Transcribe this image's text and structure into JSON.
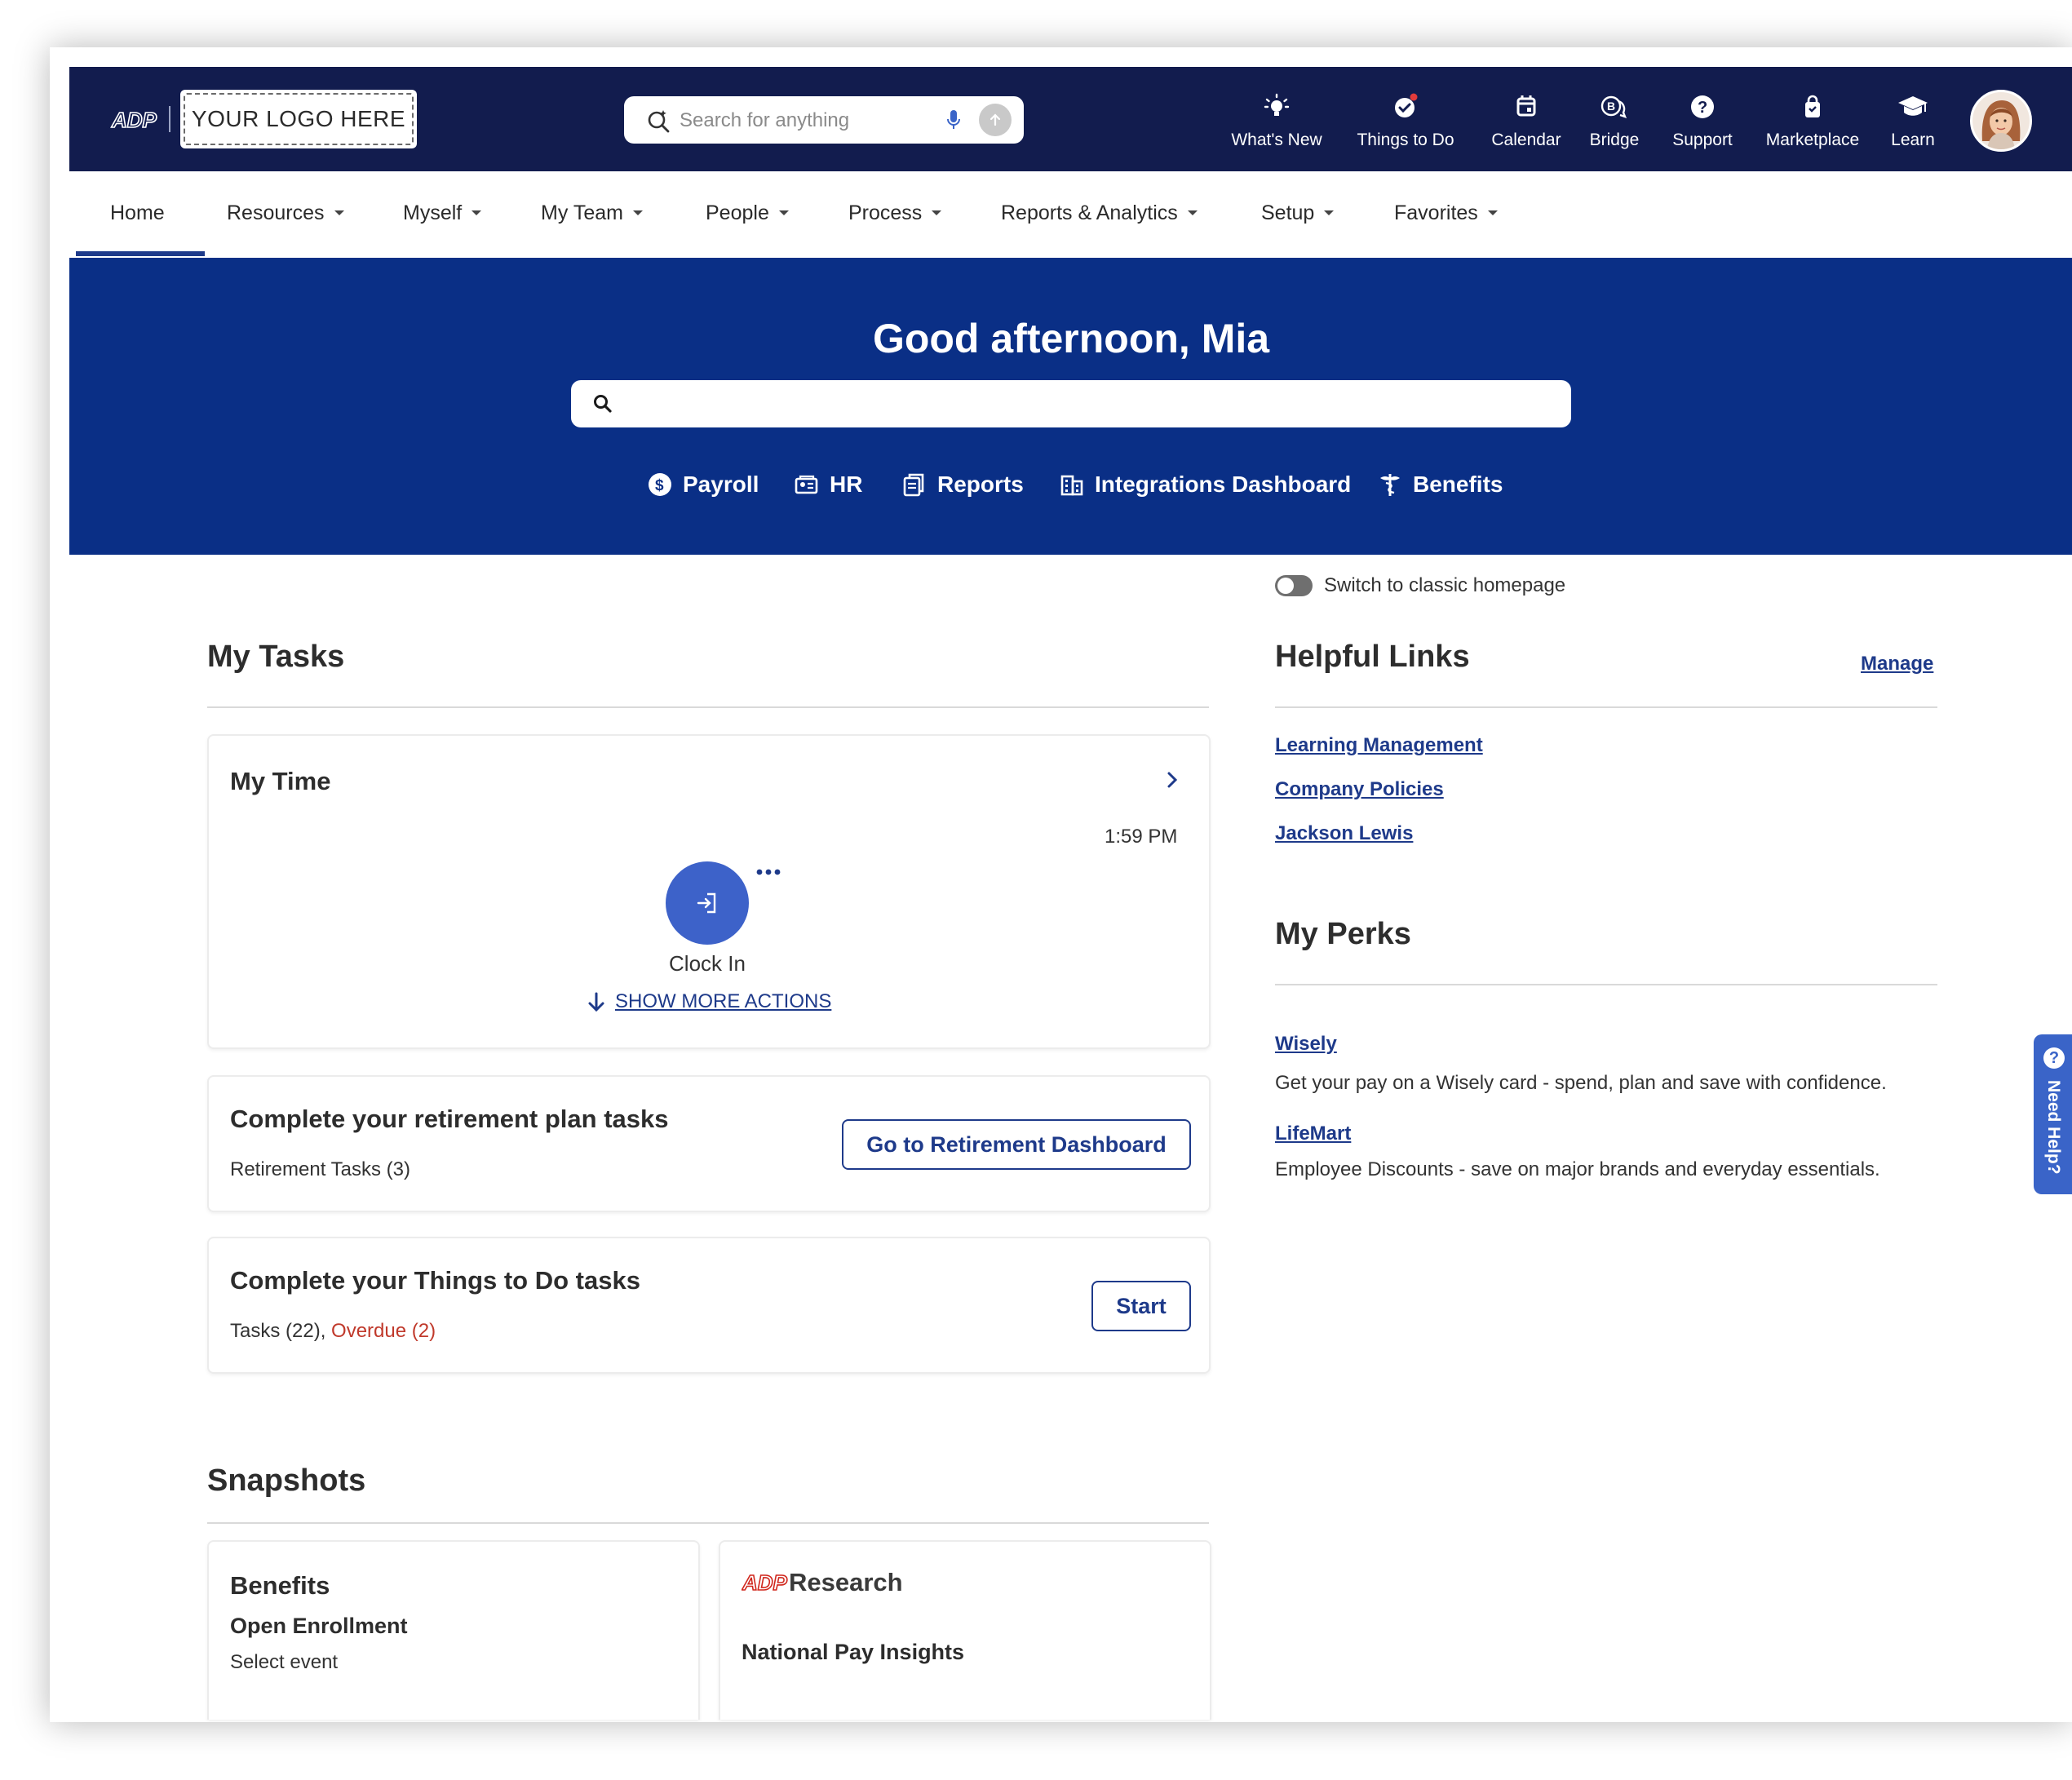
{
  "topbar": {
    "brand": "ADP",
    "logo_placeholder": "YOUR LOGO HERE",
    "search_placeholder": "Search for anything",
    "nav": [
      {
        "label": "What's New",
        "icon": "lightbulb-icon"
      },
      {
        "label": "Things to Do",
        "icon": "check-circle-icon"
      },
      {
        "label": "Calendar",
        "icon": "calendar-icon"
      },
      {
        "label": "Bridge",
        "icon": "bridge-chat-icon"
      },
      {
        "label": "Support",
        "icon": "question-circle-icon"
      },
      {
        "label": "Marketplace",
        "icon": "shopping-bag-icon"
      },
      {
        "label": "Learn",
        "icon": "graduation-cap-icon"
      }
    ]
  },
  "secnav": {
    "items": [
      {
        "label": "Home",
        "active": true
      },
      {
        "label": "Resources"
      },
      {
        "label": "Myself"
      },
      {
        "label": "My Team"
      },
      {
        "label": "People"
      },
      {
        "label": "Process"
      },
      {
        "label": "Reports & Analytics"
      },
      {
        "label": "Setup"
      },
      {
        "label": "Favorites"
      }
    ]
  },
  "hero": {
    "greeting": "Good afternoon, Mia",
    "links": [
      {
        "label": "Payroll",
        "icon": "dollar-circle-icon"
      },
      {
        "label": "HR",
        "icon": "id-card-icon"
      },
      {
        "label": "Reports",
        "icon": "reports-icon"
      },
      {
        "label": "Integrations Dashboard",
        "icon": "building-icon"
      },
      {
        "label": "Benefits",
        "icon": "caduceus-icon"
      }
    ]
  },
  "toggle": {
    "label": "Switch to classic homepage",
    "on": false
  },
  "my_tasks": {
    "title": "My Tasks",
    "my_time": {
      "title": "My Time",
      "time": "1:59 PM",
      "clock_label": "Clock In",
      "show_more": "SHOW MORE ACTIONS"
    },
    "retirement": {
      "title": "Complete your retirement plan tasks",
      "sub": "Retirement Tasks (3)",
      "button": "Go to Retirement Dashboard"
    },
    "things_to_do": {
      "title": "Complete your Things to Do tasks",
      "tasks": "Tasks (22), ",
      "overdue": "Overdue (2)",
      "button": "Start"
    }
  },
  "snapshots": {
    "title": "Snapshots",
    "benefits": {
      "title": "Benefits",
      "subtitle": "Open Enrollment",
      "line": "Select event"
    },
    "research": {
      "brand": "ADP",
      "title": "Research",
      "line": "National Pay Insights"
    }
  },
  "helpful_links": {
    "title": "Helpful Links",
    "manage": "Manage",
    "links": [
      "Learning Management",
      "Company Policies",
      "Jackson Lewis"
    ]
  },
  "my_perks": {
    "title": "My Perks",
    "perks": [
      {
        "name": "Wisely",
        "desc": "Get your pay on a Wisely card - spend, plan and save with confidence."
      },
      {
        "name": "LifeMart",
        "desc": "Employee Discounts - save on major brands and everyday essentials."
      }
    ]
  },
  "need_help": {
    "label": "Need Help?"
  },
  "colors": {
    "topbar": "#121c4e",
    "hero": "#0a2f86",
    "accent": "#1e3a8a",
    "clock_button": "#3d62c9",
    "overdue": "#c0392b"
  }
}
